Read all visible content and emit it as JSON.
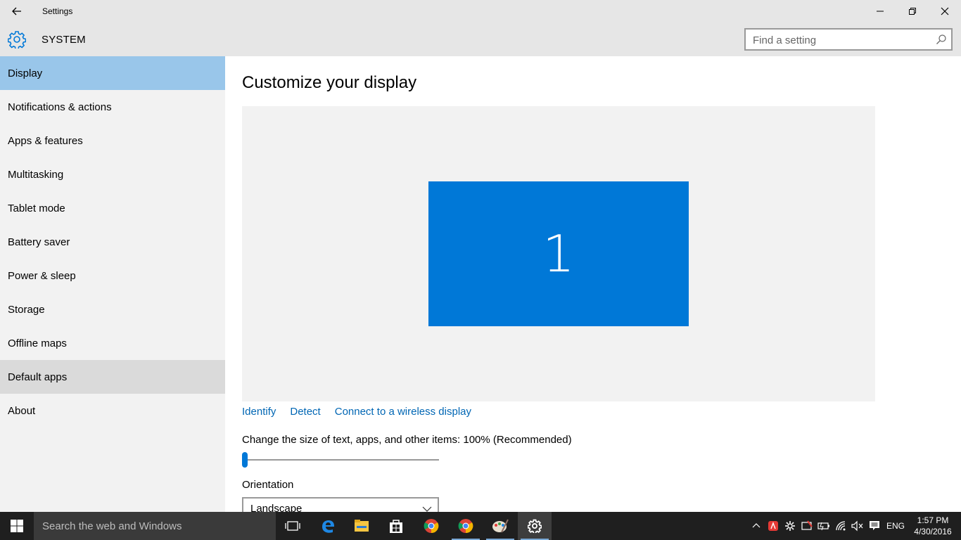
{
  "window": {
    "title": "Settings"
  },
  "header": {
    "section_title": "SYSTEM",
    "search_placeholder": "Find a setting"
  },
  "sidebar": {
    "items": [
      {
        "label": "Display",
        "state": "selected"
      },
      {
        "label": "Notifications & actions"
      },
      {
        "label": "Apps & features"
      },
      {
        "label": "Multitasking"
      },
      {
        "label": "Tablet mode"
      },
      {
        "label": "Battery saver"
      },
      {
        "label": "Power & sleep"
      },
      {
        "label": "Storage"
      },
      {
        "label": "Offline maps"
      },
      {
        "label": "Default apps",
        "state": "hover"
      },
      {
        "label": "About"
      }
    ]
  },
  "main": {
    "title": "Customize your display",
    "monitor_number": "1",
    "links": {
      "identify": "Identify",
      "detect": "Detect",
      "wireless": "Connect to a wireless display"
    },
    "scale_label": "Change the size of text, apps, and other items: 100% (Recommended)",
    "scale_value_percent": 0,
    "orientation_label": "Orientation",
    "orientation_value": "Landscape"
  },
  "taskbar": {
    "search_placeholder": "Search the web and Windows",
    "pinned": [
      "task-view-icon",
      "edge-icon",
      "file-explorer-icon",
      "store-icon",
      "chrome-icon",
      "chrome-icon",
      "paint-icon",
      "settings-icon"
    ],
    "language": "ENG",
    "time": "1:57 PM",
    "date": "4/30/2016"
  },
  "colors": {
    "accent": "#0078d7",
    "selected_nav": "#99c6ea",
    "link": "#0066b4",
    "taskbar": "#1f1f1f"
  }
}
